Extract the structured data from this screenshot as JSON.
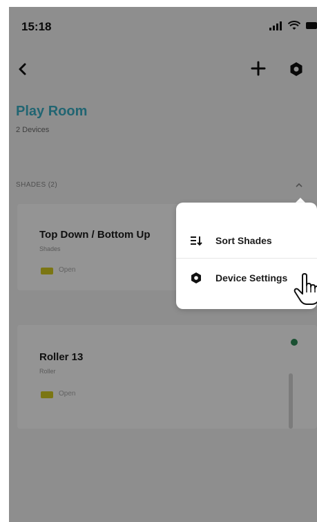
{
  "status_bar": {
    "time": "15:18"
  },
  "header": {
    "room_title": "Play Room",
    "room_subtitle": "2 Devices"
  },
  "section": {
    "label": "SHADES (2)"
  },
  "cards": [
    {
      "title": "Top Down / Bottom Up",
      "subtitle": "Shades",
      "icon_text": "Open"
    },
    {
      "title": "Roller 13",
      "subtitle": "Roller",
      "icon_text": "Open"
    }
  ],
  "menu": {
    "sort_label": "Sort Shades",
    "device_settings_label": "Device Settings"
  },
  "colors": {
    "accent": "#3aaec4",
    "overlay": "rgba(0,0,0,0.42)",
    "status_green": "#2e8b57"
  }
}
